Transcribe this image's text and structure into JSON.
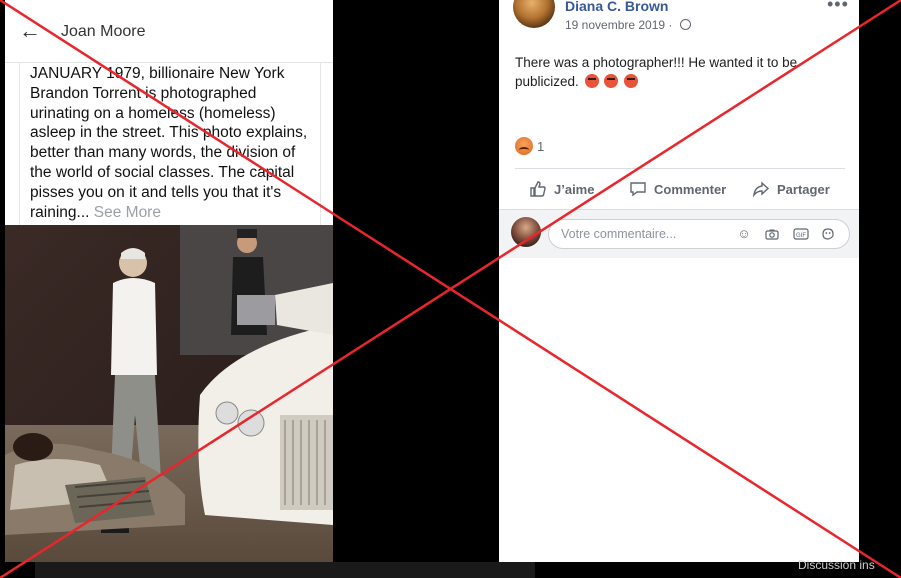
{
  "left_post": {
    "title": "Joan Moore",
    "body": "JANUARY 1979, billionaire New York Brandon Torrent is photographed urinating on a homeless (homeless) asleep in the street. This photo explains, better than many words, the division of the world of social classes. The capital pisses you on it and tells you that it's raining...",
    "see_more": "See More"
  },
  "right_post": {
    "author": "Diana C. Brown",
    "date": "19 novembre 2019 ·",
    "more": "•••",
    "text": "There was a photographer!!! He wanted it to be publicized.",
    "reaction_count": "1",
    "actions": {
      "like": "J’aime",
      "comment": "Commenter",
      "share": "Partager"
    },
    "comment_placeholder": "Votre commentaire..."
  },
  "overlay": {
    "cross_color": "#e8262c"
  },
  "footer": {
    "text": "Discussion ins"
  },
  "icons": {
    "back": "arrow-left-icon",
    "globe": "globe-icon",
    "like": "thumbs-up-icon",
    "comment": "speech-bubble-icon",
    "share": "share-arrow-icon",
    "emoji": "smiley-icon",
    "camera": "camera-icon",
    "gif": "gif-icon",
    "sticker": "sticker-icon"
  }
}
